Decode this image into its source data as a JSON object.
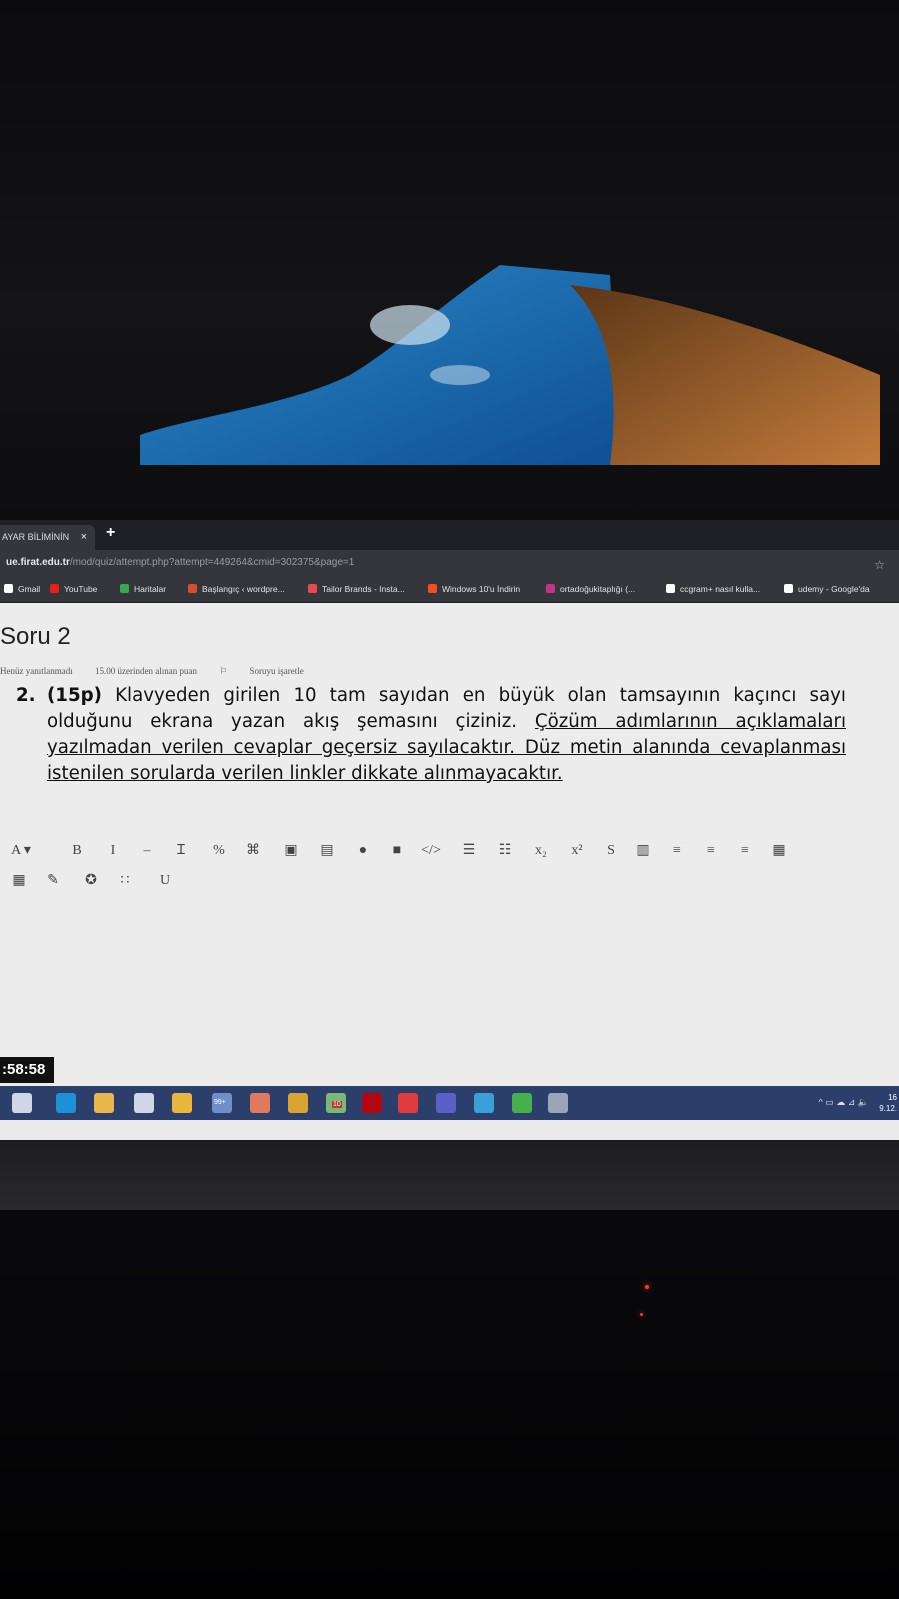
{
  "browser": {
    "tab_label": "AYAR BİLİMİNİN",
    "tab_close": "×",
    "new_tab": "+",
    "url_host": "ue.firat.edu.tr",
    "url_path": "/mod/quiz/attempt.php?attempt=449264&cmid=302375&page=1",
    "bookmarks": [
      {
        "label": "Gmail",
        "color": "#ffffff"
      },
      {
        "label": "YouTube",
        "color": "#e62117"
      },
      {
        "label": "Haritalar",
        "color": "#34a853"
      },
      {
        "label": "Başlangıç ‹ wordpre...",
        "color": "#d64e2a"
      },
      {
        "label": "Tailor Brands - Insta...",
        "color": "#e84a4a"
      },
      {
        "label": "Windows 10'u İndirin",
        "color": "#f25022"
      },
      {
        "label": "ortadoğukitaplığı (...",
        "color": "#c13584"
      },
      {
        "label": "ccgram+ nasıl kulla...",
        "color": "#ffffff"
      },
      {
        "label": "udemy - Google'da",
        "color": "#ffffff"
      }
    ]
  },
  "question": {
    "title": "Soru 2",
    "status": "Henüz yanıtlanmadı",
    "points": "15.00 üzerinden alınan puan",
    "flag": "Soruyu işaretle",
    "number": "2.",
    "points_label": "(15p)",
    "text_plain": " Klavyeden girilen 10 tam sayıdan en büyük olan tamsayının kaçıncı sayı olduğunu ekrana yazan akış şemasını çiziniz. ",
    "text_underlined": "Çözüm adımlarının açıklamaları yazılmadan verilen cevaplar geçersiz sayılacaktır. Düz metin alanında cevaplanması istenilen sorularda verilen linkler dikkate alınmayacaktır."
  },
  "editor_toolbar": {
    "row1": [
      {
        "label": "A ▾",
        "icon": "font-color-icon"
      },
      {
        "label": "B",
        "icon": "bold-icon"
      },
      {
        "label": "I",
        "icon": "italic-icon"
      },
      {
        "label": "–",
        "icon": "strikethrough-line-icon"
      },
      {
        "label": "Ɪ",
        "icon": "clear-format-icon"
      },
      {
        "label": "%",
        "icon": "link-icon"
      },
      {
        "label": "⌘",
        "icon": "unlink-icon"
      },
      {
        "label": "▣",
        "icon": "image-icon"
      },
      {
        "label": "▤",
        "icon": "media-icon"
      },
      {
        "label": "●",
        "icon": "record-audio-icon"
      },
      {
        "label": "■",
        "icon": "record-video-icon"
      },
      {
        "label": "</>",
        "icon": "html-icon"
      },
      {
        "label": "☰",
        "icon": "unordered-list-icon"
      },
      {
        "label": "☷",
        "icon": "ordered-list-icon"
      },
      {
        "label": "x₂",
        "icon": "subscript-icon"
      },
      {
        "label": "x²",
        "icon": "superscript-icon"
      },
      {
        "label": "S",
        "icon": "strike-icon"
      },
      {
        "label": "▥",
        "icon": "table-icon"
      },
      {
        "label": "≡",
        "icon": "align-left-icon"
      },
      {
        "label": "≡",
        "icon": "align-center-icon"
      },
      {
        "label": "≡",
        "icon": "align-right-icon"
      },
      {
        "label": "▦",
        "icon": "grid-icon"
      }
    ],
    "row2": [
      {
        "label": "▦",
        "icon": "calculator-icon"
      },
      {
        "label": "✎",
        "icon": "edit-icon"
      },
      {
        "label": "✪",
        "icon": "accessibility-icon"
      },
      {
        "label": "∷",
        "icon": "special-chars-icon"
      },
      {
        "label": "U",
        "icon": "underline-icon"
      }
    ]
  },
  "timer": ":58:58",
  "taskbar": {
    "icons": [
      {
        "name": "task-view-icon",
        "color": "#cfd6e6"
      },
      {
        "name": "edge-icon",
        "color": "#1e90d6"
      },
      {
        "name": "file-explorer-icon",
        "color": "#e8b64a"
      },
      {
        "name": "store-icon",
        "color": "#cfd6e6"
      },
      {
        "name": "chrome-icon",
        "color": "#e9b73c"
      },
      {
        "name": "whatsapp-icon",
        "color": "#6e8fc7"
      },
      {
        "name": "mail-icon",
        "color": "#e07a5f"
      },
      {
        "name": "app-z-icon",
        "color": "#d9a430"
      },
      {
        "name": "app-10-icon",
        "color": "#7ab87a"
      },
      {
        "name": "netflix-icon",
        "color": "#b20710"
      },
      {
        "name": "media-player-icon",
        "color": "#e03a3a"
      },
      {
        "name": "teams-icon",
        "color": "#5b5fc7"
      },
      {
        "name": "chrome-profile-icon",
        "color": "#3aa0d8"
      },
      {
        "name": "camtasia-icon",
        "color": "#46b04a"
      },
      {
        "name": "app-icon",
        "color": "#9aa4b8"
      }
    ],
    "badge_whatsapp": "99+",
    "badge_app10": "10",
    "tray": "^ ▭ ☁ ⊿ 🔈",
    "clock_time": "16",
    "clock_date": "9.12."
  }
}
